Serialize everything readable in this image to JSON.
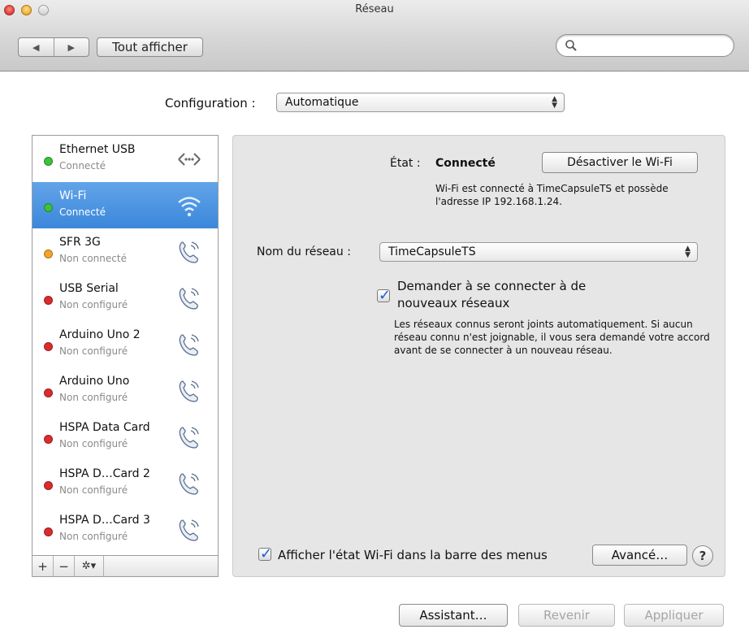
{
  "window": {
    "title": "Réseau"
  },
  "toolbar": {
    "back": "◀",
    "forward": "▶",
    "show_all": "Tout afficher",
    "search_icon": "search-icon"
  },
  "config": {
    "label": "Configuration :",
    "value": "Automatique"
  },
  "services": [
    {
      "name": "Ethernet USB",
      "status": "Connecté",
      "dot_color": "#3cc23c",
      "icon": "ethernet-icon",
      "selected": false
    },
    {
      "name": "Wi-Fi",
      "status": "Connecté",
      "dot_color": "#3cc23c",
      "icon": "wifi-icon",
      "selected": true
    },
    {
      "name": "SFR 3G",
      "status": "Non connecté",
      "dot_color": "#f3a52b",
      "icon": "phone-icon",
      "selected": false
    },
    {
      "name": "USB Serial",
      "status": "Non configuré",
      "dot_color": "#dc2b2b",
      "icon": "phone-icon",
      "selected": false
    },
    {
      "name": "Arduino Uno 2",
      "status": "Non configuré",
      "dot_color": "#dc2b2b",
      "icon": "phone-icon",
      "selected": false
    },
    {
      "name": "Arduino Uno",
      "status": "Non configuré",
      "dot_color": "#dc2b2b",
      "icon": "phone-icon",
      "selected": false
    },
    {
      "name": "HSPA Data Card",
      "status": "Non configuré",
      "dot_color": "#dc2b2b",
      "icon": "phone-icon",
      "selected": false
    },
    {
      "name": "HSPA D…Card 2",
      "status": "Non configuré",
      "dot_color": "#dc2b2b",
      "icon": "phone-icon",
      "selected": false
    },
    {
      "name": "HSPA D…Card 3",
      "status": "Non configuré",
      "dot_color": "#dc2b2b",
      "icon": "phone-icon",
      "selected": false
    }
  ],
  "sidebar_toolbar": {
    "add": "+",
    "remove": "−",
    "action": "✲▾"
  },
  "detail": {
    "state_label": "État :",
    "state_value": "Connecté",
    "disable_wifi": "Désactiver le Wi-Fi",
    "wifi_description": "Wi-Fi est connecté à TimeCapsuleTS et possède l'adresse IP 192.168.1.24.",
    "network_label": "Nom du réseau :",
    "network_value": "TimeCapsuleTS",
    "ask_join_label": "Demander à se connecter à de nouveaux réseaux",
    "ask_join_checked": true,
    "ask_join_description": "Les réseaux connus seront joints automatiquement. Si aucun réseau connu n'est joignable, il vous sera demandé votre accord avant de se connecter à un nouveau réseau.",
    "menubar_label": "Afficher l'état Wi-Fi dans la barre des menus",
    "menubar_checked": true,
    "advanced": "Avancé…",
    "help": "?"
  },
  "footer": {
    "assistant": "Assistant…",
    "revert": "Revenir",
    "apply": "Appliquer"
  },
  "colors": {
    "selection": "#3b87db",
    "panel": "#e6e6e6",
    "check": "#1a5fd1"
  }
}
